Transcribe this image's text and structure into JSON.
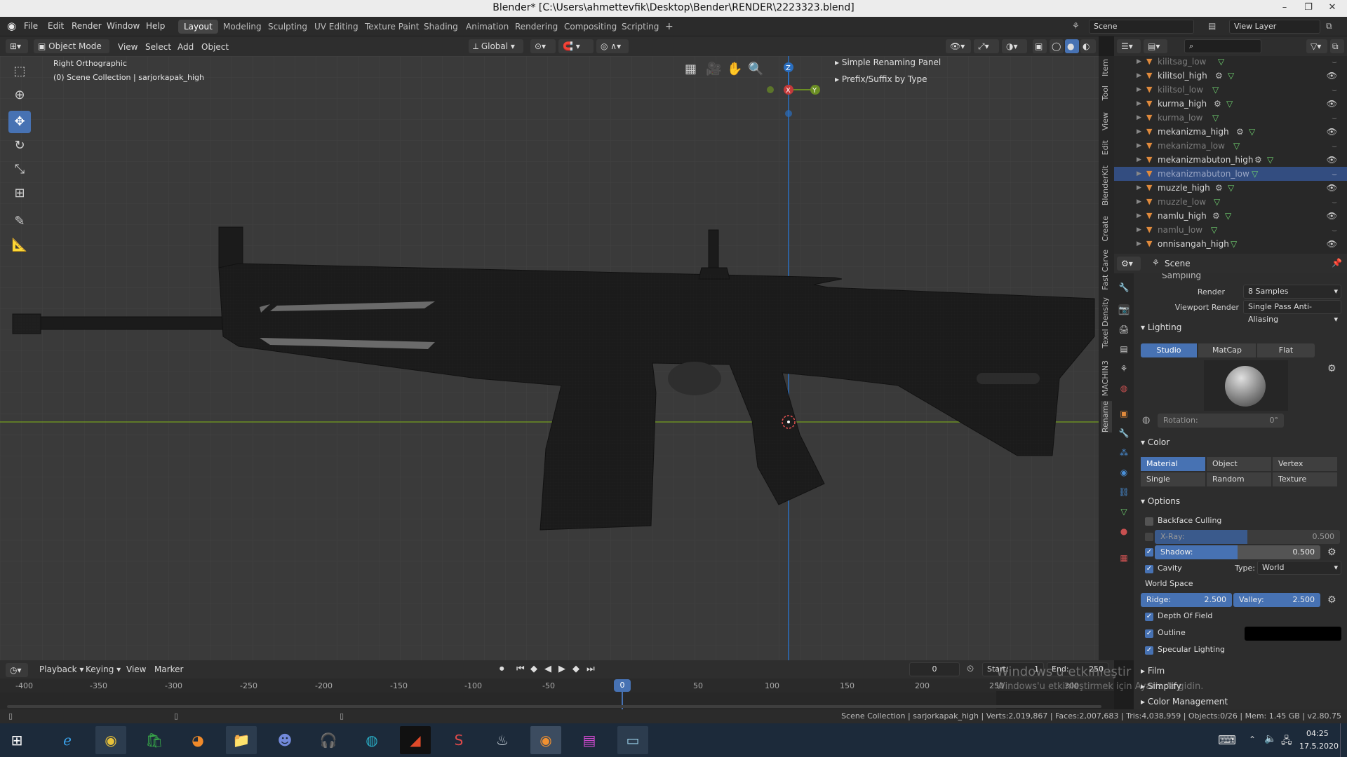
{
  "window": {
    "title": "Blender* [C:\\Users\\ahmettevfik\\Desktop\\Bender\\RENDER\\2223323.blend]",
    "minimize": "–",
    "maximize": "❐",
    "close": "✕"
  },
  "menu": {
    "items": [
      "File",
      "Edit",
      "Render",
      "Window",
      "Help"
    ]
  },
  "workspaces": {
    "tabs": [
      "Layout",
      "Modeling",
      "Sculpting",
      "UV Editing",
      "Texture Paint",
      "Shading",
      "Animation",
      "Rendering",
      "Compositing",
      "Scripting"
    ],
    "active": "Layout",
    "add": "+"
  },
  "scene": {
    "name": "Scene",
    "view_layer": "View Layer"
  },
  "viewport_header": {
    "mode": "Object Mode",
    "menus": [
      "View",
      "Select",
      "Add",
      "Object"
    ],
    "orientation": "Global"
  },
  "viewport": {
    "view_name": "Right Orthographic",
    "collection_info": "(0) Scene Collection | sarjorkapak_high",
    "panels": [
      "Simple Renaming Panel",
      "Prefix/Suffix by Type"
    ],
    "gizmo": {
      "z": "Z",
      "y": "Y",
      "x": "X"
    },
    "colors": {
      "axis_y": "#6b8e23",
      "axis_z": "#2a6ebf",
      "gun": "#1b1b1b"
    }
  },
  "sidebar_tabs": [
    "Item",
    "Tool",
    "View",
    "Edit",
    "BlenderKit",
    "Create",
    "Fast Carve",
    "Texel Density",
    "MACHIN3",
    "Rename"
  ],
  "outliner": {
    "rows": [
      {
        "name": "kilitsag_low",
        "visible": false,
        "modifier": false,
        "selected": false
      },
      {
        "name": "kilitsol_high",
        "visible": true,
        "modifier": true,
        "selected": false
      },
      {
        "name": "kilitsol_low",
        "visible": false,
        "modifier": false,
        "selected": false
      },
      {
        "name": "kurma_high",
        "visible": true,
        "modifier": true,
        "selected": false
      },
      {
        "name": "kurma_low",
        "visible": false,
        "modifier": false,
        "selected": false
      },
      {
        "name": "mekanizma_high",
        "visible": true,
        "modifier": true,
        "selected": false
      },
      {
        "name": "mekanizma_low",
        "visible": false,
        "modifier": false,
        "selected": false
      },
      {
        "name": "mekanizmabuton_high",
        "visible": true,
        "modifier": true,
        "selected": false
      },
      {
        "name": "mekanizmabuton_low",
        "visible": false,
        "modifier": false,
        "selected": true
      },
      {
        "name": "muzzle_high",
        "visible": true,
        "modifier": true,
        "selected": false
      },
      {
        "name": "muzzle_low",
        "visible": false,
        "modifier": false,
        "selected": false
      },
      {
        "name": "namlu_high",
        "visible": true,
        "modifier": true,
        "selected": false
      },
      {
        "name": "namlu_low",
        "visible": false,
        "modifier": false,
        "selected": false
      },
      {
        "name": "onnisangah_high",
        "visible": true,
        "modifier": false,
        "selected": false
      }
    ]
  },
  "properties": {
    "header": "Scene",
    "sampling_label": "Sampling",
    "render_label": "Render",
    "render_value": "8 Samples",
    "viewport_render_label": "Viewport Render",
    "viewport_render_value": "Single Pass Anti-Aliasing",
    "lighting": {
      "title": "Lighting",
      "options": [
        "Studio",
        "MatCap",
        "Flat"
      ],
      "active": "Studio",
      "rotation_label": "Rotation:",
      "rotation_value": "0°"
    },
    "color": {
      "title": "Color",
      "options": [
        "Material",
        "Object",
        "Vertex",
        "Single",
        "Random",
        "Texture"
      ],
      "active": "Material"
    },
    "options": {
      "title": "Options",
      "backface_culling": "Backface Culling",
      "xray_label": "X-Ray:",
      "xray_value": "0.500",
      "xray_fraction": 0.5,
      "shadow_label": "Shadow:",
      "shadow_value": "0.500",
      "shadow_fraction": 0.5,
      "cavity": "Cavity",
      "type_label": "Type:",
      "type_value": "World",
      "world_space": "World Space",
      "ridge_label": "Ridge:",
      "ridge_value": "2.500",
      "valley_label": "Valley:",
      "valley_value": "2.500",
      "depth_of_field": "Depth Of Field",
      "outline": "Outline",
      "specular": "Specular Lighting"
    },
    "collapsed": [
      "Film",
      "Simplify",
      "Color Management"
    ]
  },
  "timeline": {
    "menus": [
      "Playback",
      "Keying",
      "View",
      "Marker"
    ],
    "current_frame": "0",
    "start_label": "Start:",
    "start": "1",
    "end_label": "End:",
    "end": "250",
    "ticks": [
      "-400",
      "-350",
      "-300",
      "-250",
      "-200",
      "-150",
      "-100",
      "-50",
      "0",
      "50",
      "100",
      "150",
      "200",
      "250",
      "300"
    ]
  },
  "activation_watermark": {
    "line1": "Windows'u etkinleştir",
    "line2": "Windows'u etkinleştirmek için Ayarlar'a gidin."
  },
  "status": {
    "text": "Scene Collection | sarjorkapak_high | Verts:2,019,867 | Faces:2,007,683 | Tris:4,038,959 | Objects:0/26 | Mem: 1.45 GB | v2.80.75"
  },
  "taskbar": {
    "time": "04:25",
    "date": "17.5.2020"
  }
}
